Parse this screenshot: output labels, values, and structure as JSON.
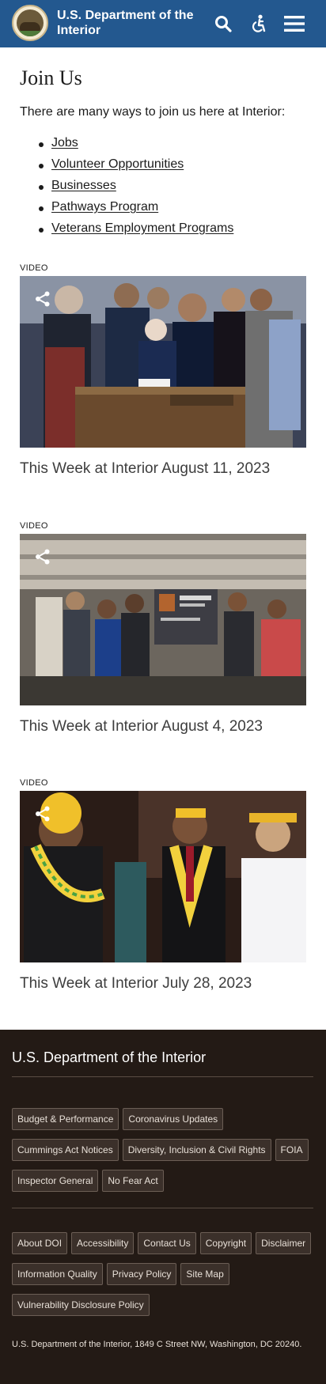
{
  "header": {
    "brand_title": "U.S. Department of the Interior",
    "icons": [
      "seal-logo",
      "search-icon",
      "accessibility-icon",
      "menu-icon"
    ],
    "background_color": "#23588f"
  },
  "main": {
    "title": "Join Us",
    "intro": "There are many ways to join us here at Interior:",
    "links": [
      {
        "label": "Jobs"
      },
      {
        "label": "Volunteer Opportunities"
      },
      {
        "label": "Businesses"
      },
      {
        "label": "Pathways Program"
      },
      {
        "label": "Veterans Employment Programs"
      }
    ],
    "videos": [
      {
        "tag": "VIDEO",
        "title": "This Week at Interior August 11, 2023"
      },
      {
        "tag": "VIDEO",
        "title": "This Week at Interior August 4, 2023"
      },
      {
        "tag": "VIDEO",
        "title": "This Week at Interior July 28, 2023"
      }
    ]
  },
  "footer": {
    "title": "U.S. Department of the Interior",
    "group1": [
      "Budget & Performance",
      "Coronavirus Updates",
      "Cummings Act Notices",
      "Diversity, Inclusion & Civil Rights",
      "FOIA",
      "Inspector General",
      "No Fear Act"
    ],
    "group2": [
      "About DOI",
      "Accessibility",
      "Contact Us",
      "Copyright",
      "Disclaimer",
      "Information Quality",
      "Privacy Policy",
      "Site Map",
      "Vulnerability Disclosure Policy"
    ],
    "address": "U.S. Department of the Interior, 1849 C Street NW, Washington, DC 20240.",
    "background_color": "#231a15"
  }
}
